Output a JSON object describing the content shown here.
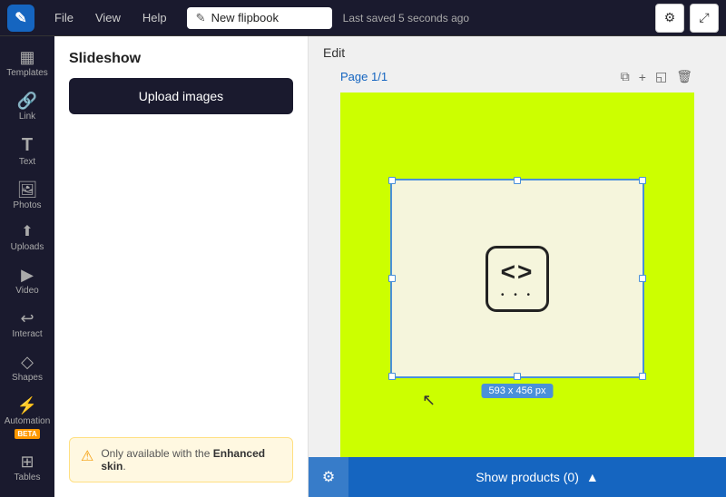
{
  "topbar": {
    "logo_icon": "✎",
    "menu_items": [
      "File",
      "View",
      "Help"
    ],
    "flipbook_title": "New flipbook",
    "save_status": "Last saved 5 seconds ago",
    "settings_icon": "⚙",
    "share_icon": "⤢"
  },
  "sidebar": {
    "items": [
      {
        "id": "templates",
        "icon": "▦",
        "label": "Templates"
      },
      {
        "id": "link",
        "icon": "🔗",
        "label": "Link"
      },
      {
        "id": "text",
        "icon": "T",
        "label": "Text"
      },
      {
        "id": "photos",
        "icon": "🖼",
        "label": "Photos"
      },
      {
        "id": "uploads",
        "icon": "⬆",
        "label": "Uploads"
      },
      {
        "id": "video",
        "icon": "▶",
        "label": "Video"
      },
      {
        "id": "interact",
        "icon": "↩",
        "label": "Interact"
      },
      {
        "id": "shapes",
        "icon": "◇",
        "label": "Shapes"
      },
      {
        "id": "automation",
        "icon": "⚡",
        "label": "Automation",
        "badge": "BETA"
      },
      {
        "id": "tables",
        "icon": "⊞",
        "label": "Tables"
      }
    ]
  },
  "left_panel": {
    "title": "Slideshow",
    "upload_button": "Upload images",
    "warning": {
      "icon": "⚠",
      "text_before": "Only available with the ",
      "text_bold": "Enhanced skin",
      "text_after": "."
    }
  },
  "edit_area": {
    "section_label": "Edit",
    "page_label": "Page 1/1",
    "page_actions": {
      "copy_icon": "⧉",
      "add_icon": "+",
      "duplicate_icon": "◱",
      "delete_icon": "🗑"
    },
    "size_badge": "593 x 456 px",
    "bottom_bar": {
      "gear_icon": "⚙",
      "show_products_label": "Show products (0)",
      "chevron_icon": "▲"
    }
  }
}
